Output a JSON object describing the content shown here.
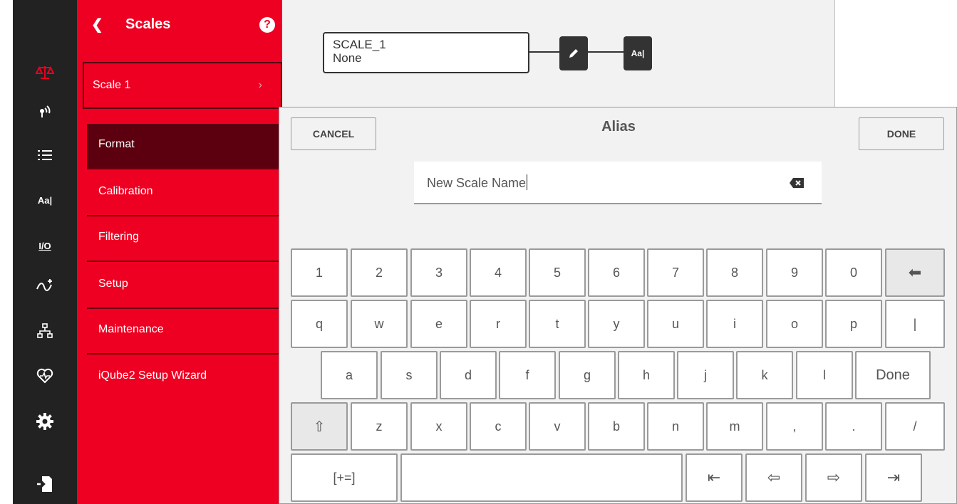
{
  "sidebar": {
    "icons": [
      "scale-icon",
      "antenna-icon",
      "list-icon",
      "alias-icon",
      "io-icon",
      "signal-icon",
      "network-icon",
      "health-icon",
      "gear-icon",
      "export-icon"
    ],
    "alias_icon_text": "Aa|",
    "io_icon_text": "I/O"
  },
  "menu": {
    "title": "Scales",
    "help_label": "?",
    "scale_item": "Scale 1",
    "items": [
      "Format",
      "Calibration",
      "Filtering",
      "Setup",
      "Maintenance",
      "iQube2 Setup Wizard"
    ],
    "selected": "Format"
  },
  "diagram": {
    "name": "SCALE_1",
    "value": "None",
    "alias_button": "Aa|"
  },
  "dialog": {
    "title": "Alias",
    "cancel": "CANCEL",
    "done": "DONE",
    "input_value": "New Scale Name"
  },
  "keyboard": {
    "row1": [
      "1",
      "2",
      "3",
      "4",
      "5",
      "6",
      "7",
      "8",
      "9",
      "0"
    ],
    "row2": [
      "q",
      "w",
      "e",
      "r",
      "t",
      "y",
      "u",
      "i",
      "o",
      "p",
      "|"
    ],
    "row3": [
      "a",
      "s",
      "d",
      "f",
      "g",
      "h",
      "j",
      "k",
      "l",
      "Done"
    ],
    "row4": [
      "z",
      "x",
      "c",
      "v",
      "b",
      "n",
      "m",
      ",",
      ".",
      "/"
    ],
    "symbols_key": "[+=]",
    "shift_glyph": "⇧",
    "backspace_glyph": "⬅",
    "home_glyph": "⇤",
    "left_glyph": "⇦",
    "right_glyph": "⇨",
    "end_glyph": "⇥"
  },
  "colors": {
    "brand_red": "#ee0022",
    "selected_red": "#5c0010",
    "rail": "#222222"
  }
}
